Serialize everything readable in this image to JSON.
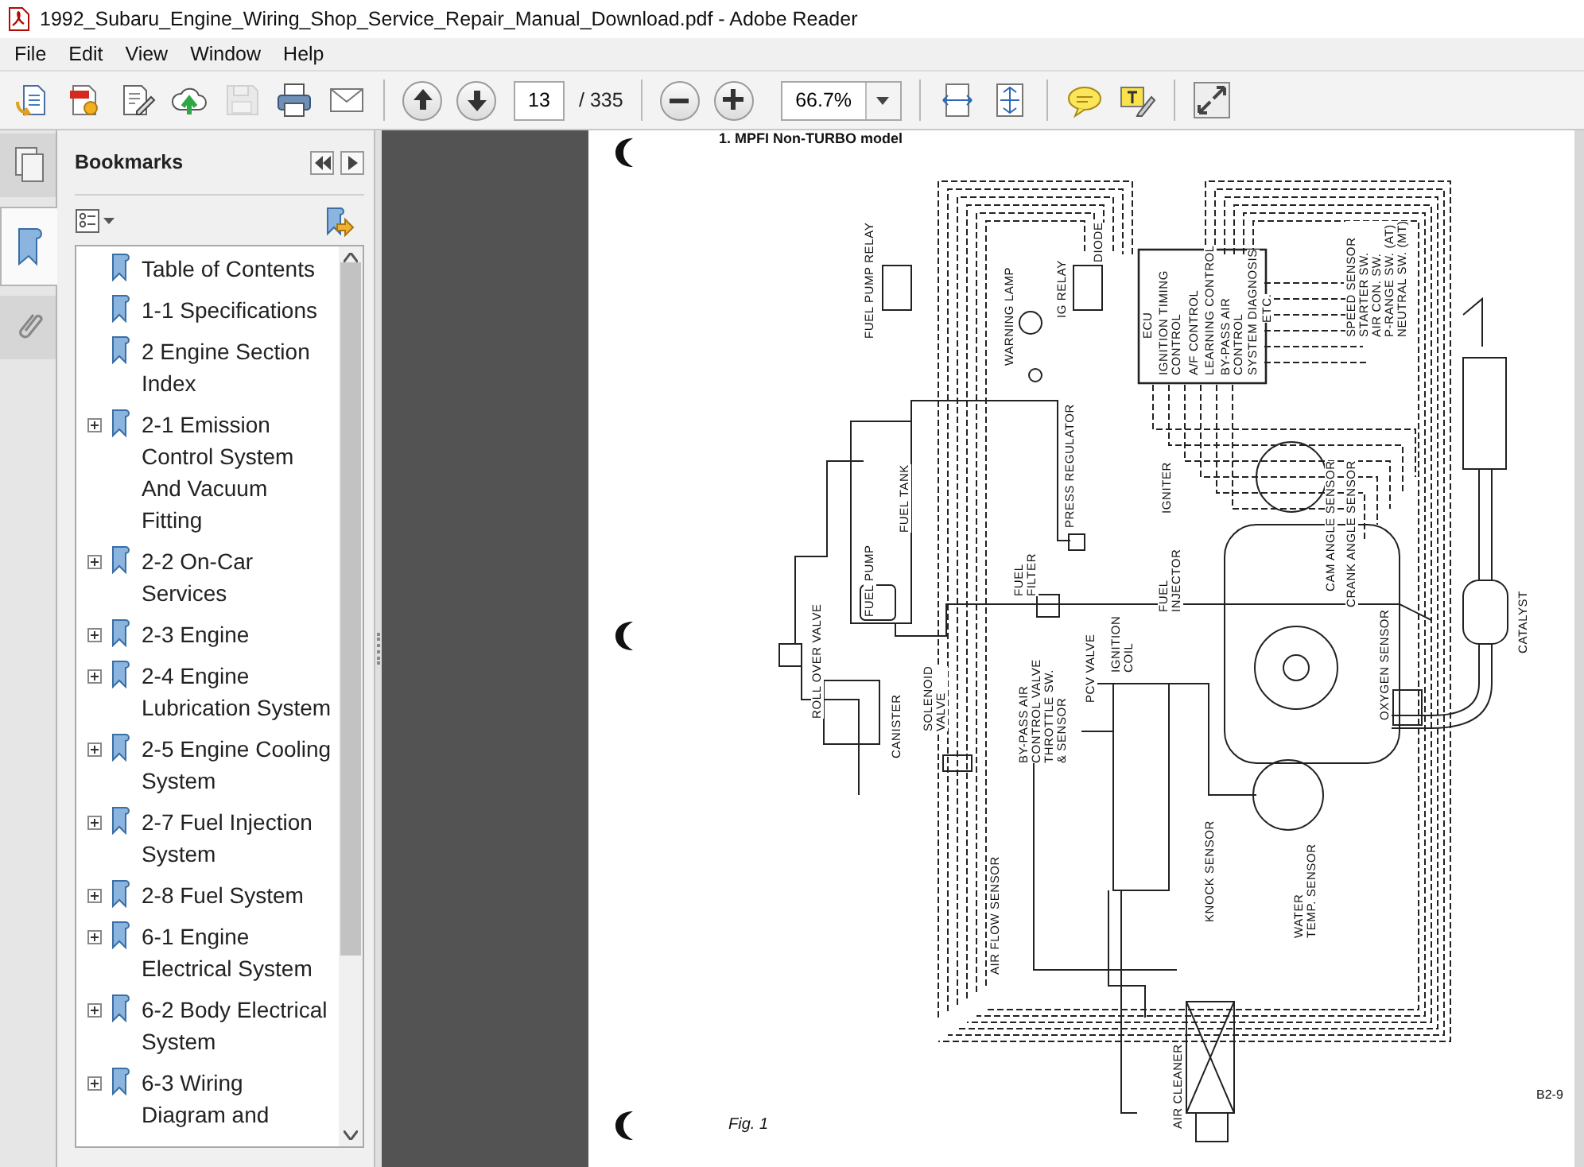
{
  "window": {
    "title": "1992_Subaru_Engine_Wiring_Shop_Service_Repair_Manual_Download.pdf - Adobe Reader"
  },
  "menu": [
    "File",
    "Edit",
    "View",
    "Window",
    "Help"
  ],
  "toolbar_groups": [
    [
      {
        "kind": "open",
        "disabled": false
      },
      {
        "kind": "create",
        "disabled": false
      },
      {
        "kind": "edit",
        "disabled": false
      },
      {
        "kind": "upload",
        "disabled": false
      },
      {
        "kind": "save",
        "disabled": true
      },
      {
        "kind": "print",
        "disabled": false
      },
      {
        "kind": "email",
        "disabled": false
      }
    ],
    [
      {
        "kind": "previous"
      },
      {
        "kind": "next"
      },
      {
        "kind": "page_field",
        "value": "13"
      },
      {
        "kind": "page_total",
        "text": "/ 335"
      }
    ],
    [
      {
        "kind": "zoom_out"
      },
      {
        "kind": "zoom_in"
      },
      {
        "kind": "zoom_field",
        "value": "66.7%"
      }
    ],
    [
      {
        "kind": "fit_width"
      },
      {
        "kind": "fit_page"
      }
    ],
    [
      {
        "kind": "comment"
      },
      {
        "kind": "highlight"
      }
    ],
    [
      {
        "kind": "full_screen"
      }
    ]
  ],
  "nav_tabs": [
    {
      "kind": "pages",
      "selected": false
    },
    {
      "kind": "bookmarks",
      "selected": true
    },
    {
      "kind": "attachments",
      "selected": false
    }
  ],
  "bookmarks": {
    "title": "Bookmarks",
    "items": [
      {
        "label": "Table of Contents",
        "kind": "leaf"
      },
      {
        "label": "1-1 Specifications",
        "kind": "leaf"
      },
      {
        "label": "2 Engine Section Index",
        "kind": "leaf"
      },
      {
        "label": "2-1 Emission Control System And Vacuum Fitting",
        "kind": "collapsed"
      },
      {
        "label": "2-2 On-Car Services",
        "kind": "collapsed"
      },
      {
        "label": "2-3 Engine",
        "kind": "collapsed"
      },
      {
        "label": "2-4 Engine Lubrication System",
        "kind": "collapsed"
      },
      {
        "label": "2-5 Engine Cooling System",
        "kind": "collapsed"
      },
      {
        "label": "2-7 Fuel Injection System",
        "kind": "collapsed"
      },
      {
        "label": "2-8 Fuel System",
        "kind": "collapsed"
      },
      {
        "label": "6-1 Engine Electrical System",
        "kind": "collapsed"
      },
      {
        "label": "6-2 Body Electrical System",
        "kind": "collapsed"
      },
      {
        "label": "6-3 Wiring Diagram and",
        "kind": "collapsed"
      }
    ]
  },
  "document": {
    "heading": "1.  MPFI Non-TURBO model",
    "labels": [
      "FUEL PUMP RELAY",
      "WARNING LAMP",
      "IG RELAY",
      "DIODE",
      "ECU",
      "IGNITION TIMING\nCONTROL",
      "A/F CONTROL",
      "LEARNING CONTROL",
      "BY-PASS AIR\nCONTROL",
      "SYSTEM DIAGNOSIS",
      "ETC.",
      "SPEED SENSOR\nSTARTER SW.\nAIR CON. SW.\nP-RANGE SW. (AT)\nNEUTRAL SW. (MT)",
      "FUEL TANK",
      "FUEL PUMP",
      "PRESS REGULATOR",
      "FUEL\nFILTER",
      "FUEL\nINJECTOR",
      "IGNITER",
      "CAM ANGLE SENSOR",
      "CRANK ANGLE SENSOR",
      "ROLL OVER VALVE",
      "CANISTER",
      "SOLENOID\nVALVE",
      "BY-PASS AIR\nCONTROL VALVE\nTHROTTLE SW.\n& SENSOR",
      "PCV VALVE",
      "IGNITION\nCOIL",
      "OXYGEN SENSOR",
      "KNOCK SENSOR",
      "WATER\nTEMP. SENSOR",
      "AIR FLOW SENSOR",
      "AIR CLEANER",
      "CATALYST"
    ],
    "caption": "Fig. 1",
    "code": "B2-9"
  }
}
